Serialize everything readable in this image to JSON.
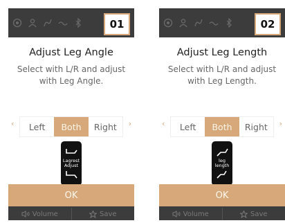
{
  "colors": {
    "accent": "#d7a87a",
    "dark_bg": "#3c3c3c",
    "icon_bg": "#111111"
  },
  "screens": [
    {
      "badge": "01",
      "title": "Adjust Leg Angle",
      "instruction": "Select with L/R and adjust with Leg Angle.",
      "options": [
        "Left",
        "Both",
        "Right"
      ],
      "selected": "Both",
      "icon_label": "Lagrest Adjust",
      "icon_name": "leg-angle-adjust-icon",
      "ok_label": "OK",
      "volume_label": "Volume",
      "save_label": "Save"
    },
    {
      "badge": "02",
      "title": "Adjust Leg Length",
      "instruction": "Select with L/R and adjust with Leg Length.",
      "options": [
        "Left",
        "Both",
        "Right"
      ],
      "selected": "Both",
      "icon_label": "leg length",
      "icon_name": "leg-length-adjust-icon",
      "ok_label": "OK",
      "volume_label": "Volume",
      "save_label": "Save"
    }
  ],
  "status_icons": [
    "settings-icon",
    "user-icon",
    "massage-icon",
    "wave-icon",
    "bluetooth-icon"
  ]
}
